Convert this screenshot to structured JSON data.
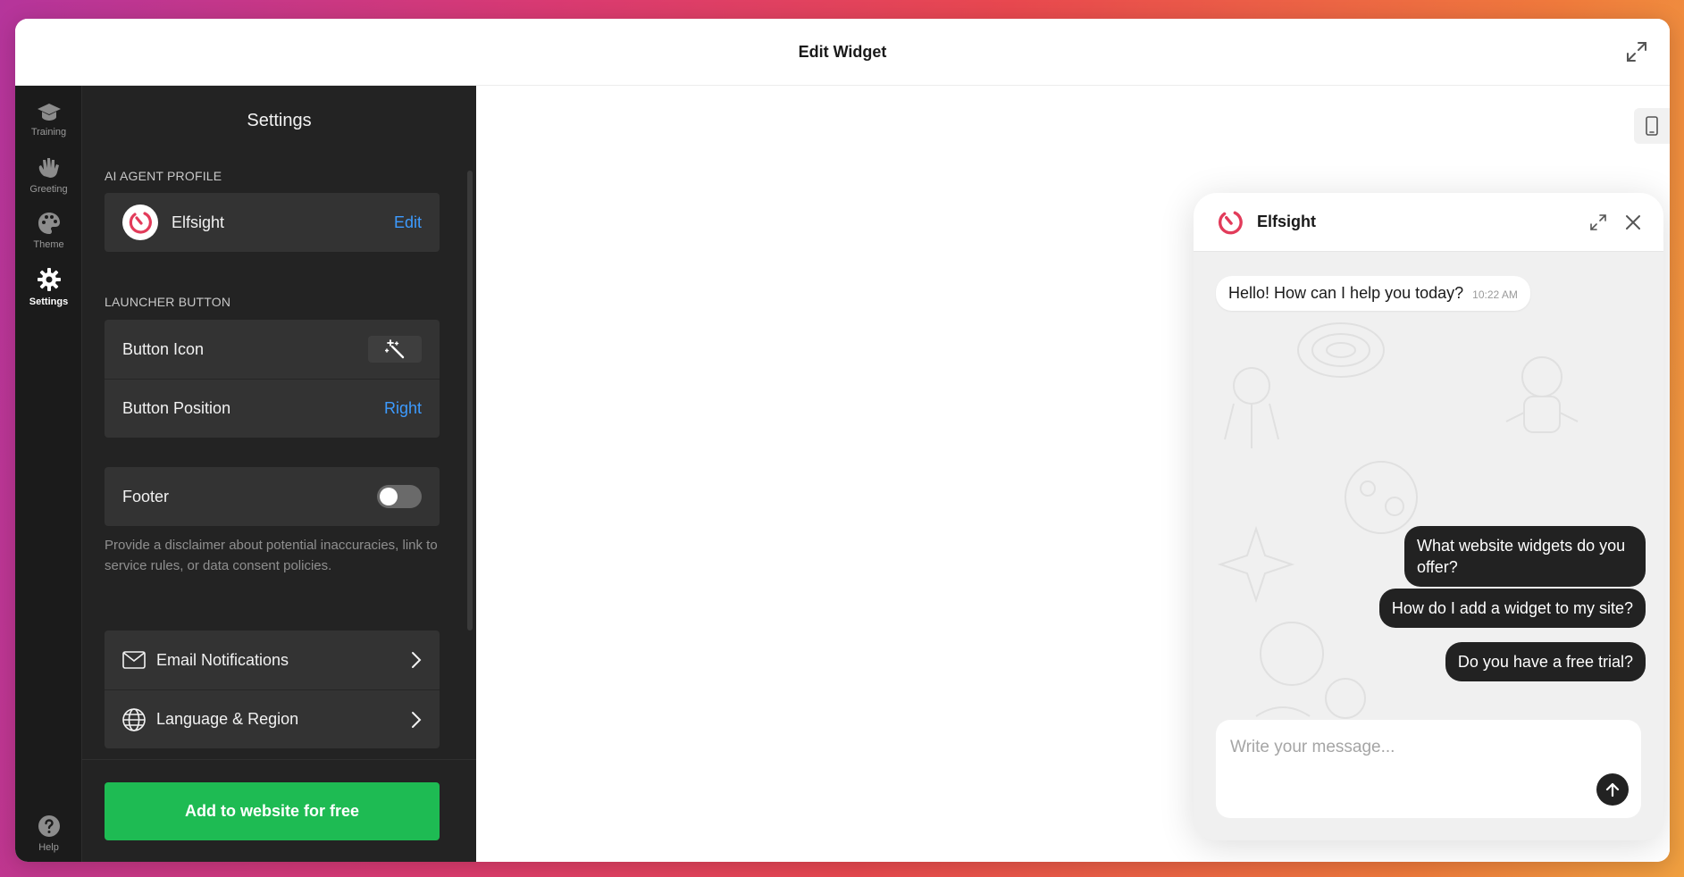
{
  "topbar": {
    "title": "Edit Widget",
    "expand_icon": "expand-icon"
  },
  "rail": {
    "items": [
      {
        "label": "Training",
        "icon": "graduation-cap-icon"
      },
      {
        "label": "Greeting",
        "icon": "wave-hand-icon"
      },
      {
        "label": "Theme",
        "icon": "palette-icon"
      },
      {
        "label": "Settings",
        "icon": "gear-icon",
        "active": true
      }
    ],
    "help": {
      "label": "Help",
      "icon": "question-icon"
    }
  },
  "panel": {
    "title": "Settings",
    "ai_profile": {
      "heading": "AI AGENT PROFILE",
      "name": "Elfsight",
      "action": "Edit"
    },
    "launcher": {
      "heading": "LAUNCHER BUTTON",
      "icon_label": "Button Icon",
      "position_label": "Button Position",
      "position_value": "Right"
    },
    "footer": {
      "label": "Footer",
      "enabled": false,
      "hint": "Provide a disclaimer about potential inaccuracies, link to service rules, or data consent policies."
    },
    "links": [
      {
        "label": "Email Notifications",
        "icon": "envelope-icon"
      },
      {
        "label": "Language & Region",
        "icon": "globe-icon"
      }
    ],
    "cta": "Add to website for free"
  },
  "preview": {
    "chat": {
      "name": "Elfsight",
      "greeting": "Hello! How can I help you today?",
      "greeting_time": "10:22 AM",
      "suggestions": [
        "What website widgets do you offer?",
        "How do I add a widget to my site?",
        "Do you have a free trial?"
      ],
      "placeholder": "Write your message..."
    }
  },
  "colors": {
    "accent_link": "#3d9bff",
    "cta": "#1ebb53",
    "panel_bg": "#232323",
    "rail_bg": "#1b1b1b",
    "brand_logo": "#e23b5a"
  }
}
